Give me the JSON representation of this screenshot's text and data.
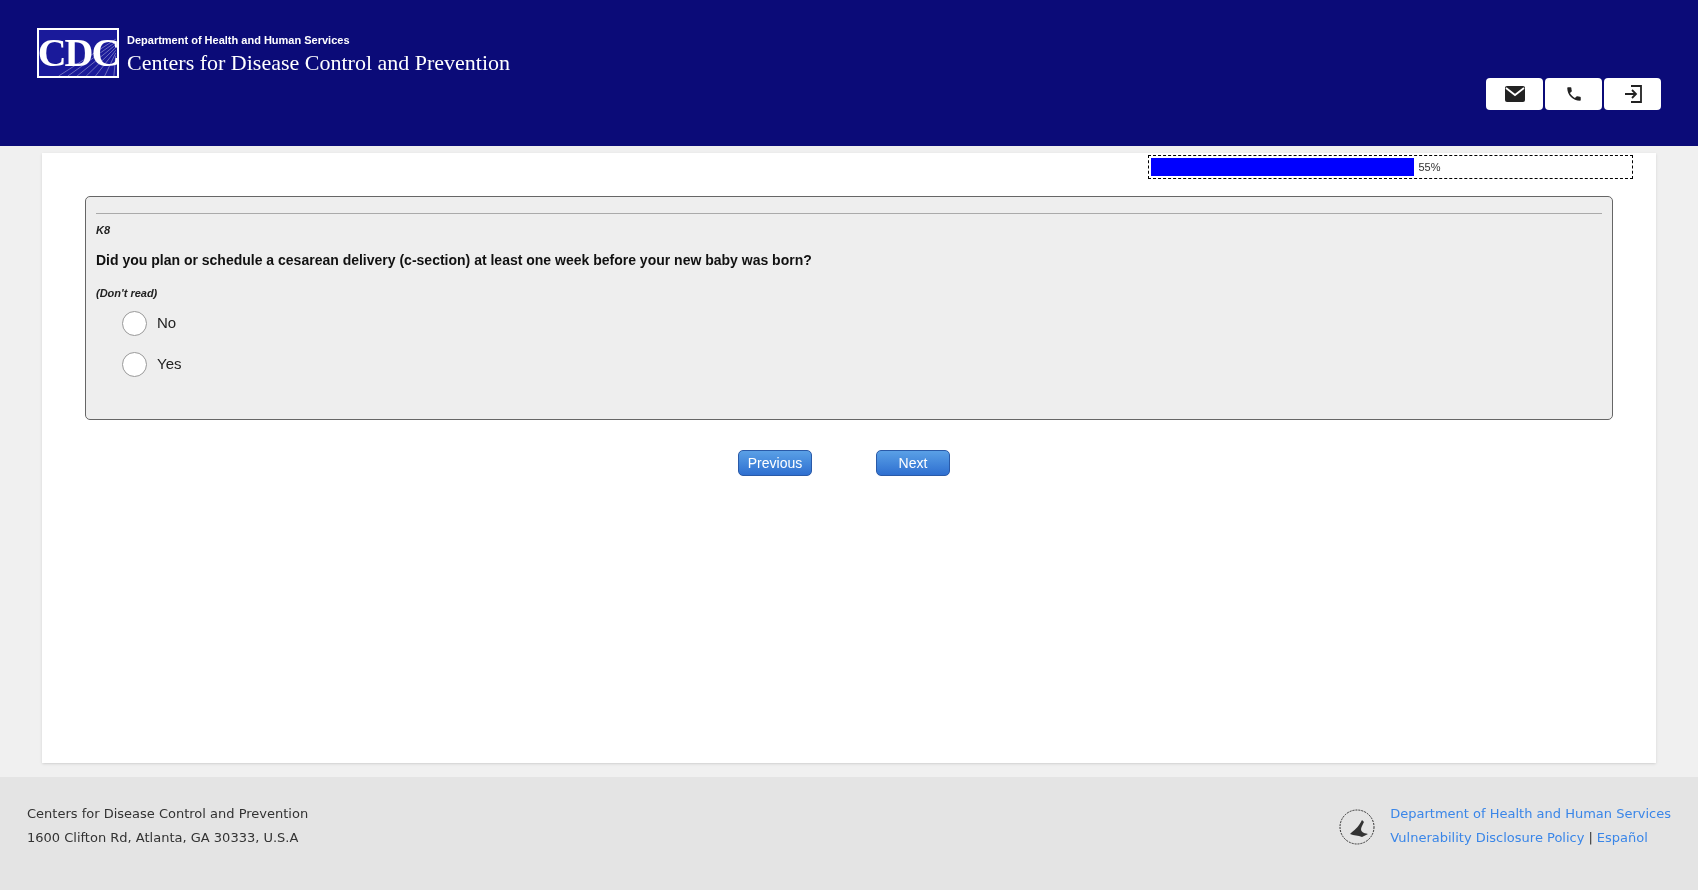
{
  "header": {
    "logo": "CDC",
    "department": "Department of Health and Human Services",
    "agency": "Centers for Disease Control and Prevention"
  },
  "progress": {
    "level": 0.55,
    "reading": "55%"
  },
  "question": {
    "code": "K8",
    "text": "Did you plan or schedule a cesarean delivery (c-section) at least one week before your new baby was born?",
    "instruction": "(Don't read)",
    "options": [
      {
        "label": "No",
        "selected": false
      },
      {
        "label": "Yes",
        "selected": false
      }
    ]
  },
  "navigation": [
    "Previous",
    "Next"
  ],
  "footer": {
    "address": [
      "Centers for Disease Control and Prevention",
      "1600 Clifton Rd, Atlanta, GA 30333, U.S.A"
    ],
    "department_link": "Department of Health and Human Services",
    "policy_link": "Vulnerability Disclosure Policy",
    "separator": "|",
    "language_link": "Español"
  }
}
